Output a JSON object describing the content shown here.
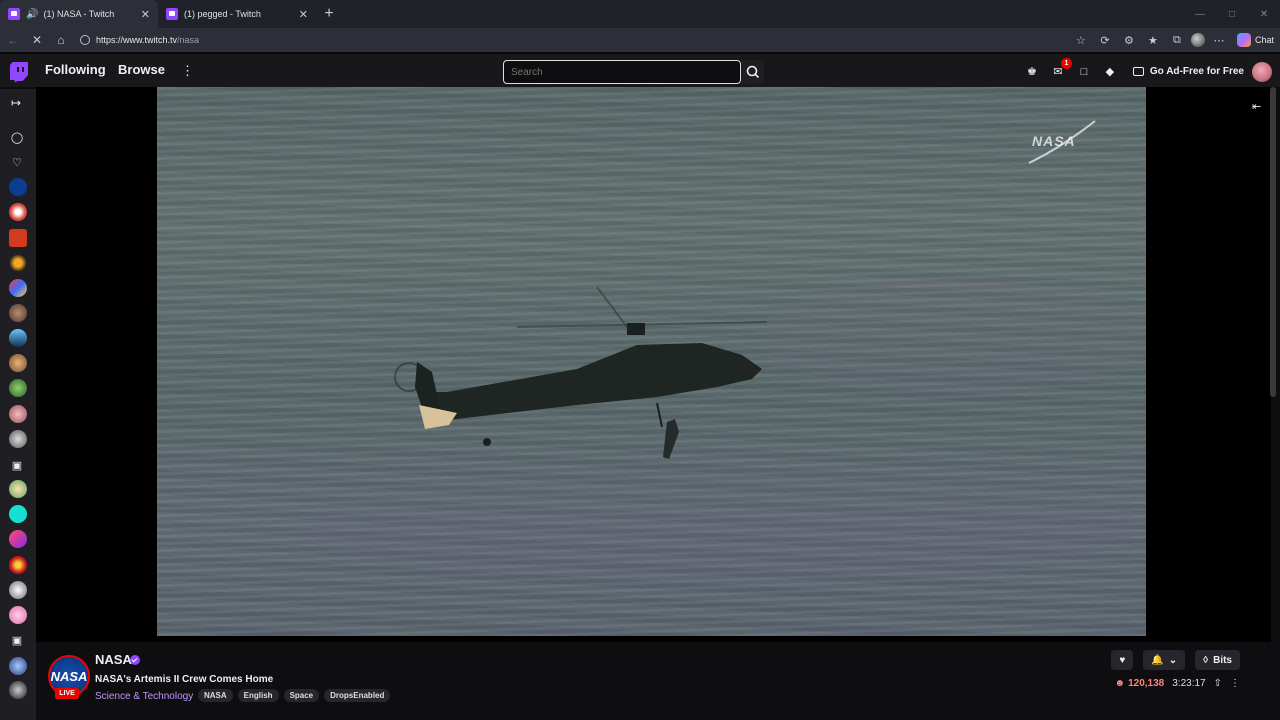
{
  "browser": {
    "tabs": [
      {
        "title": "(1) NASA - Twitch",
        "active": true,
        "audio": true
      },
      {
        "title": "(1) pegged - Twitch",
        "active": false,
        "audio": false
      }
    ],
    "url_host": "https://www.twitch.tv",
    "url_path": "/nasa",
    "copilot_label": "Chat"
  },
  "twitch_nav": {
    "following": "Following",
    "browse": "Browse",
    "search_placeholder": "Search",
    "notification_count": "1",
    "ad_free": "Go Ad-Free for Free"
  },
  "video": {
    "watermark": "NASA"
  },
  "channel": {
    "avatar_text": "NASA",
    "live_label": "LIVE",
    "name": "NASA",
    "stream_title": "NASA's Artemis II Crew Comes Home",
    "category": "Science & Technology",
    "tags": [
      "NASA",
      "English",
      "Space",
      "DropsEnabled"
    ],
    "bits_label": "Bits",
    "viewers": "120,138",
    "uptime": "3:23:17"
  },
  "colors": {
    "twitch_purple": "#9146ff",
    "live_red": "#eb0400",
    "viewer_red": "#ff8280"
  }
}
